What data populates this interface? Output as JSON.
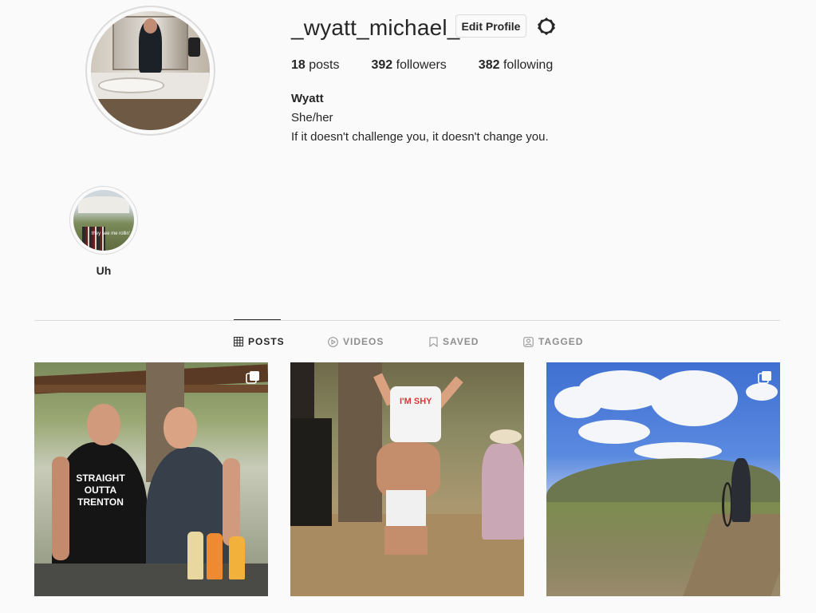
{
  "profile": {
    "username": "_wyatt_michael_",
    "edit_label": "Edit Profile",
    "stats": {
      "posts_count": "18",
      "posts_label": "posts",
      "followers_count": "392",
      "followers_label": "followers",
      "following_count": "382",
      "following_label": "following"
    },
    "full_name": "Wyatt",
    "pronouns": "She/her",
    "bio": "If it doesn't challenge you, it doesn't change you."
  },
  "highlights": [
    {
      "label": "Uh",
      "image_caption": "they see me rollin'"
    }
  ],
  "tabs": [
    {
      "label": "POSTS",
      "icon": "grid-icon",
      "active": true
    },
    {
      "label": "VIDEOS",
      "icon": "play-circle-icon",
      "active": false
    },
    {
      "label": "SAVED",
      "icon": "bookmark-icon",
      "active": false
    },
    {
      "label": "TAGGED",
      "icon": "tag-person-icon",
      "active": false
    }
  ],
  "posts": [
    {
      "shirt_text": "STRAIGHT OUTTA TRENTON",
      "multi": true
    },
    {
      "shirt_text": "I'M SHY",
      "multi": false
    },
    {
      "multi": true
    }
  ],
  "colors": {
    "background": "#fafafa",
    "text": "#262626",
    "muted": "#8e8e8e",
    "border": "#dbdbdb"
  }
}
